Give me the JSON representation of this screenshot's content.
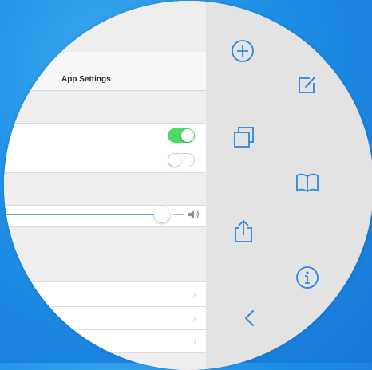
{
  "settings_panel": {
    "title": "App Settings",
    "toggle_1_on": true,
    "toggle_2_on": false,
    "slider_value": 0.84
  },
  "toolbar": {
    "icons": [
      "add-icon",
      "compose-icon",
      "copy-icon",
      "book-icon",
      "share-icon",
      "info-icon",
      "back-icon"
    ]
  },
  "colors": {
    "accent": "#2f86de",
    "toggle_on": "#4cd964",
    "background": "#1f8fe6"
  }
}
